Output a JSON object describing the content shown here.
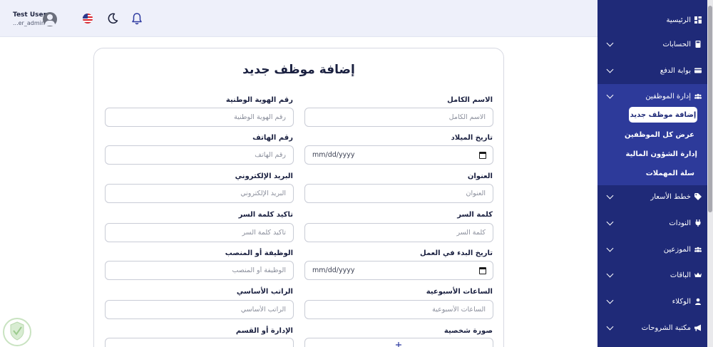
{
  "header": {
    "user_name": "Test User",
    "user_role": "...er_admin"
  },
  "sidebar": {
    "items": [
      {
        "label": "الرئيسية",
        "icon": "dashboard-icon"
      },
      {
        "label": "الحسابات",
        "icon": "calculator-icon"
      },
      {
        "label": "بوابة الدفع",
        "icon": "credit-card-icon"
      },
      {
        "label": "إدارة الموظفين",
        "icon": "users-icon"
      },
      {
        "label": "خطط الأسعار",
        "icon": "tag-icon"
      },
      {
        "label": "النودات",
        "icon": "plug-icon"
      },
      {
        "label": "الموزعين",
        "icon": "users-icon"
      },
      {
        "label": "الباقات",
        "icon": "crown-icon"
      },
      {
        "label": "الوكلاء",
        "icon": "user-icon"
      },
      {
        "label": "مكتبة الشروحات",
        "icon": "megaphone-icon"
      }
    ],
    "sub_items": [
      "إضافة موظف جديد",
      "عرض كل الموظفين",
      "إدارة الشؤون المالية",
      "سلة المهملات"
    ]
  },
  "form": {
    "title": "إضافة موظف جديد",
    "fields": {
      "full_name": {
        "label": "الاسم الكامل",
        "placeholder": "الاسم الكامل"
      },
      "national_id": {
        "label": "رقم الهوية الوطنية",
        "placeholder": "رقم الهوية الوطنية"
      },
      "birth_date": {
        "label": "تاريخ الميلاد",
        "value": "mm/dd/yyyy"
      },
      "phone": {
        "label": "رقم الهاتف",
        "placeholder": "رقم الهاتف"
      },
      "address": {
        "label": "العنوان",
        "placeholder": "العنوان"
      },
      "email": {
        "label": "البريد الإلكتروني",
        "placeholder": "البريد الإلكتروني"
      },
      "password": {
        "label": "كلمة السر",
        "placeholder": "كلمة السر"
      },
      "confirm_password": {
        "label": "تاكيد كلمة السر",
        "placeholder": "تاكيد كلمة السر"
      },
      "start_date": {
        "label": "تاريخ البدء في العمل",
        "value": "mm/dd/yyyy"
      },
      "job_title": {
        "label": "الوظيفة أو المنصب",
        "placeholder": "الوظيفة أو المنصب"
      },
      "weekly_hours": {
        "label": "الساعات الأسبوعية",
        "placeholder": "الساعات الأسبوعية"
      },
      "base_salary": {
        "label": "الراتب الأساسي",
        "placeholder": "الراتب الأساسي"
      },
      "photo": {
        "label": "صورة شخصية"
      },
      "department": {
        "label": "الإدارة أو القسم"
      }
    }
  },
  "colors": {
    "sidebar_bg": "#1f2a78",
    "sidebar_group_bg": "#2d3a9a",
    "header_bg": "#eef0fa"
  }
}
